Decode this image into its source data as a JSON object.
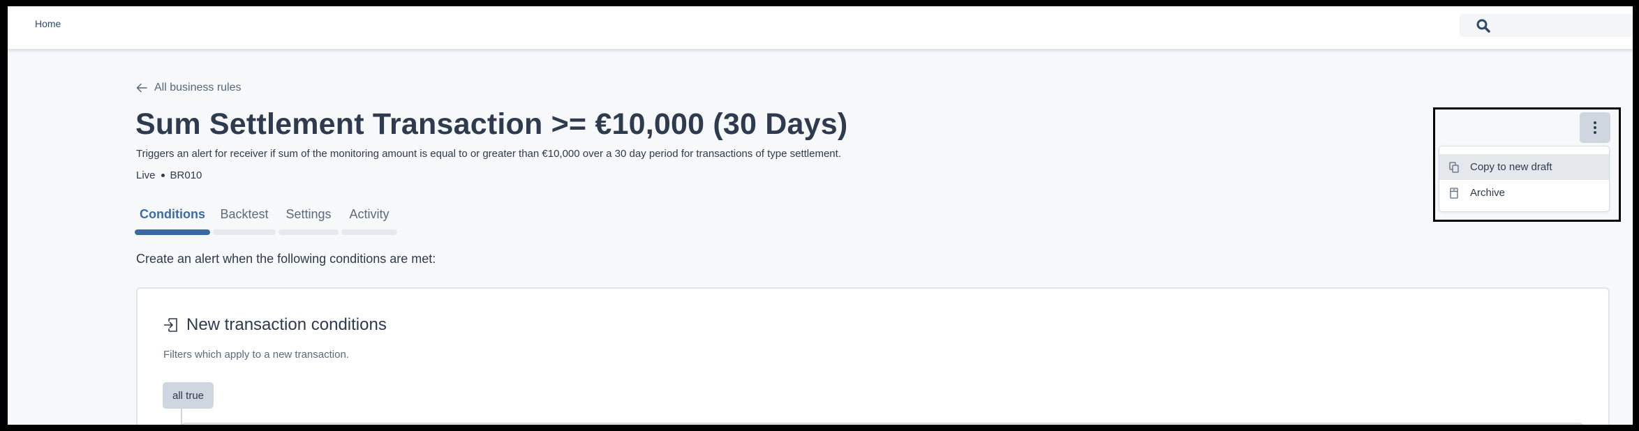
{
  "nav": {
    "home_label": "Home",
    "search_icon": "search-icon"
  },
  "breadcrumb": {
    "back_label": "All business rules",
    "icon": "arrow-left-icon"
  },
  "rule": {
    "title": "Sum Settlement Transaction >= €10,000 (30 Days)",
    "description": "Triggers an alert for receiver if sum of the monitoring amount is equal to or greater than €10,000 over a 30 day period for transactions of type settlement.",
    "status": "Live",
    "code": "BR010"
  },
  "tabs": [
    {
      "label": "Conditions",
      "active": true
    },
    {
      "label": "Backtest",
      "active": false
    },
    {
      "label": "Settings",
      "active": false
    },
    {
      "label": "Activity",
      "active": false
    }
  ],
  "intro": "Create an alert when the following conditions are met:",
  "card": {
    "icon": "enter-icon",
    "title": "New transaction conditions",
    "subtitle": "Filters which apply to a new transaction.",
    "group_operator": "all true"
  },
  "actions_menu": {
    "trigger_icon": "kebab-icon",
    "items": [
      {
        "label": "Copy to new draft",
        "icon": "copy-icon",
        "hovered": true
      },
      {
        "label": "Archive",
        "icon": "archive-icon",
        "hovered": false
      }
    ]
  },
  "colors": {
    "accent": "#3b6aa3",
    "text": "#2e3a4d",
    "muted": "#5b6a7e",
    "button_bg": "#cfd6df"
  }
}
